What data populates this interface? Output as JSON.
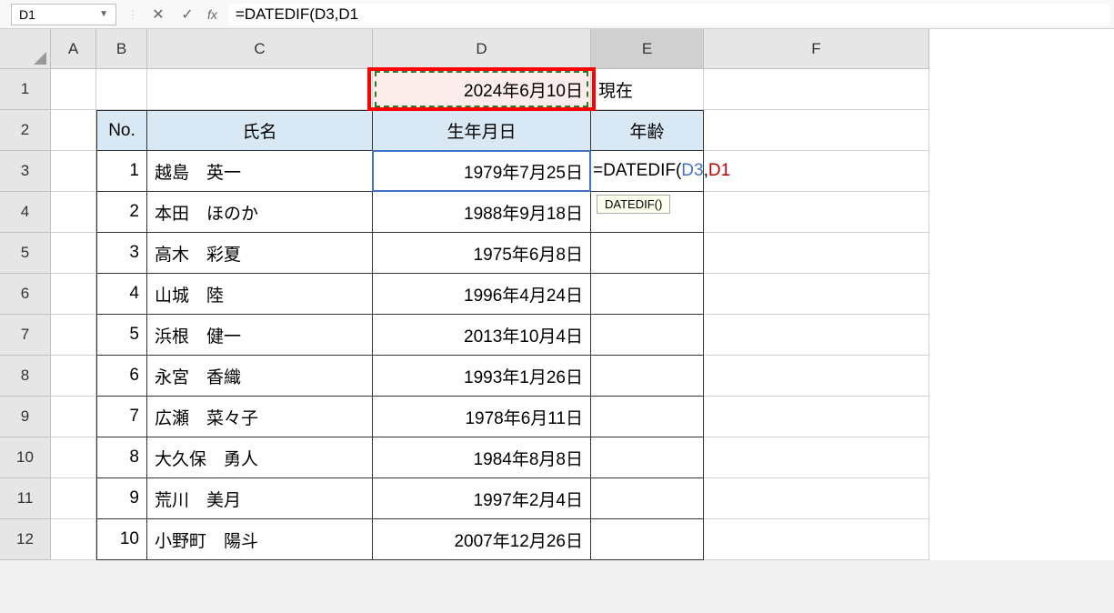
{
  "formula_bar": {
    "name_box": "D1",
    "formula": "=DATEDIF(D3,D1"
  },
  "columns": [
    "A",
    "B",
    "C",
    "D",
    "E",
    "F"
  ],
  "row_numbers": [
    "1",
    "2",
    "3",
    "4",
    "5",
    "6",
    "7",
    "8",
    "9",
    "10",
    "11",
    "12"
  ],
  "current_date": "2024年6月10日",
  "current_label": "現在",
  "headers": {
    "no": "No.",
    "name": "氏名",
    "birth": "生年月日",
    "age": "年齢"
  },
  "formula_display": {
    "prefix": "=DATEDIF(",
    "ref1": "D3",
    "comma": ",",
    "ref2": "D1"
  },
  "tooltip": "DATEDIF()",
  "rows": [
    {
      "no": "1",
      "name": "越島　英一",
      "birth": "1979年7月25日"
    },
    {
      "no": "2",
      "name": "本田　ほのか",
      "birth": "1988年9月18日"
    },
    {
      "no": "3",
      "name": "高木　彩夏",
      "birth": "1975年6月8日"
    },
    {
      "no": "4",
      "name": "山城　陸",
      "birth": "1996年4月24日"
    },
    {
      "no": "5",
      "name": "浜根　健一",
      "birth": "2013年10月4日"
    },
    {
      "no": "6",
      "name": "永宮　香織",
      "birth": "1993年1月26日"
    },
    {
      "no": "7",
      "name": "広瀬　菜々子",
      "birth": "1978年6月11日"
    },
    {
      "no": "8",
      "name": "大久保　勇人",
      "birth": "1984年8月8日"
    },
    {
      "no": "9",
      "name": "荒川　美月",
      "birth": "1997年2月4日"
    },
    {
      "no": "10",
      "name": "小野町　陽斗",
      "birth": "2007年12月26日"
    }
  ]
}
